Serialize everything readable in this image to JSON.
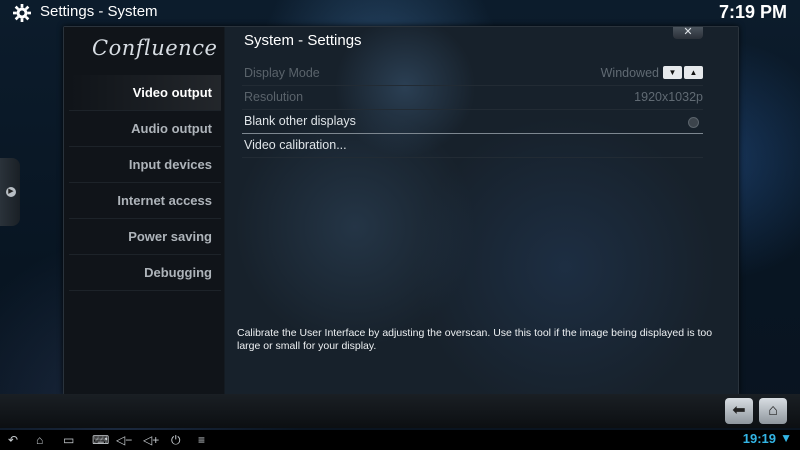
{
  "window": {
    "title": "Settings  - System",
    "clock": "7:19 PM"
  },
  "brand": {
    "logo_text": "Confluence"
  },
  "sidebar": {
    "items": [
      {
        "label": "Video output",
        "selected": true
      },
      {
        "label": "Audio output",
        "selected": false
      },
      {
        "label": "Input devices",
        "selected": false
      },
      {
        "label": "Internet access",
        "selected": false
      },
      {
        "label": "Power saving",
        "selected": false
      },
      {
        "label": "Debugging",
        "selected": false
      }
    ]
  },
  "main": {
    "title": "System - Settings",
    "close_label": "✕",
    "settings": [
      {
        "label": "Display Mode",
        "value": "Windowed",
        "enabled": false,
        "control": "spinner"
      },
      {
        "label": "Resolution",
        "value": "1920x1032p",
        "enabled": false,
        "control": "value"
      },
      {
        "label": "Blank other displays",
        "value": "",
        "enabled": true,
        "control": "radio",
        "checked": false
      },
      {
        "label": "Video calibration...",
        "value": "",
        "enabled": true,
        "control": "button"
      }
    ],
    "spinner_down": "▼",
    "spinner_up": "▲",
    "description": "Calibrate the User Interface by adjusting the overscan. Use this tool if the image being displayed is too large or small for your display."
  },
  "bottom": {
    "back_icon": "⬅",
    "home_icon": "⌂"
  },
  "android_nav": {
    "icons": [
      "↶",
      "⌂",
      "▭",
      "⌨",
      "◁−",
      "◁+",
      "⏻",
      "≡"
    ],
    "clock": "19:19",
    "wifi_icon": "▼"
  },
  "colors": {
    "accent_blue": "#33b5e5",
    "panel": "#141b22",
    "text_disabled": "#5a636b"
  }
}
